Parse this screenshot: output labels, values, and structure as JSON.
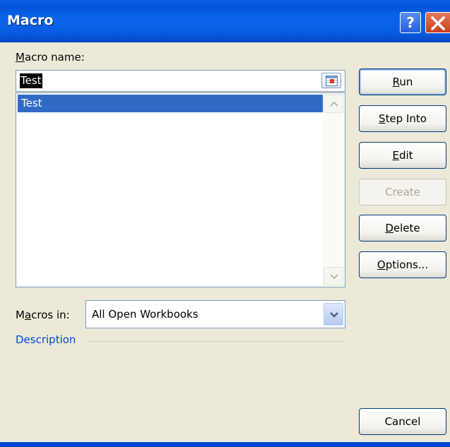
{
  "window": {
    "title": "Macro",
    "help_glyph": "?",
    "close_icon": "close-x-icon"
  },
  "macro_name": {
    "label_access_key": "M",
    "label_rest": "acro name:",
    "value": "Test",
    "collapse_icon": "range-select-icon"
  },
  "macro_list": {
    "items": [
      "Test"
    ],
    "selected_index": 0
  },
  "buttons": {
    "run": {
      "key": "R",
      "rest": "un"
    },
    "step_into": {
      "key": "S",
      "rest": "tep Into"
    },
    "edit": {
      "key": "E",
      "rest": "dit"
    },
    "create": {
      "label": "Create"
    },
    "delete": {
      "key": "D",
      "rest": "elete"
    },
    "options": {
      "key": "O",
      "rest": "ptions..."
    },
    "cancel": {
      "label": "Cancel"
    }
  },
  "macros_in": {
    "label_pre": "M",
    "label_key": "a",
    "label_post": "cros in:",
    "value": "All Open Workbooks"
  },
  "description": {
    "label": "Description"
  },
  "colors": {
    "titlebar": "#0a5fe6",
    "selection": "#316ac5",
    "accent_text": "#0046d5"
  }
}
